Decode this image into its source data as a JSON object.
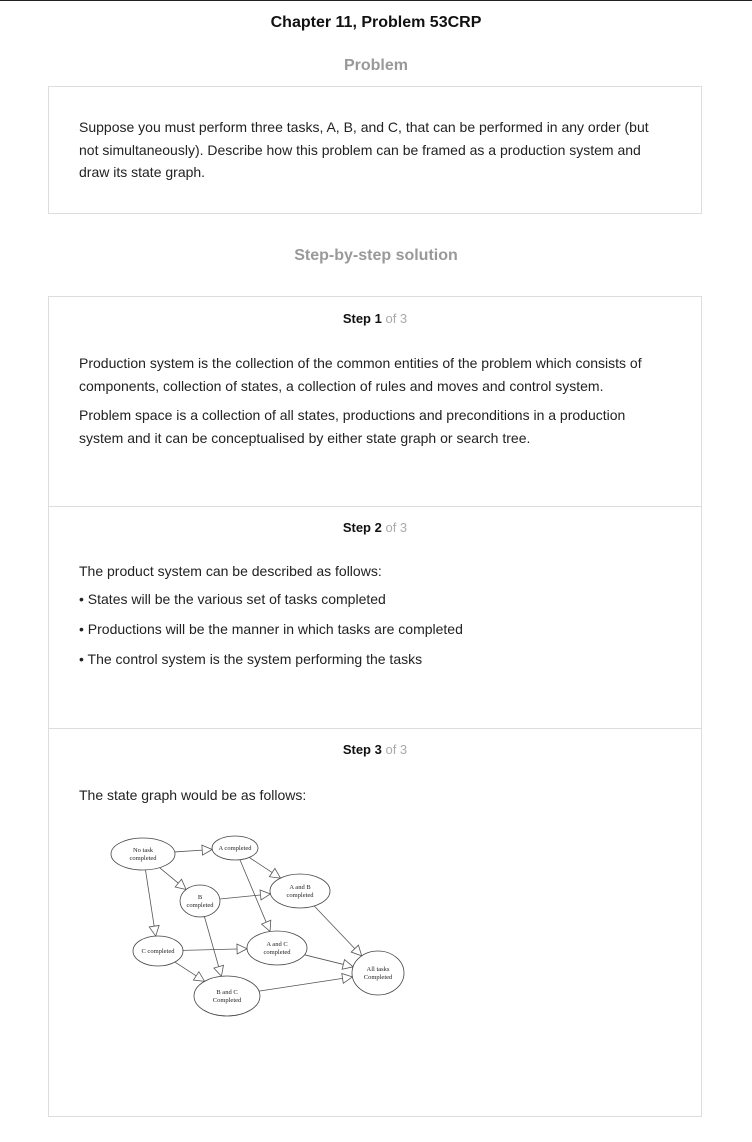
{
  "header": {
    "title": "Chapter 11, Problem 53CRP"
  },
  "problem": {
    "heading": "Problem",
    "text": "Suppose you must perform three tasks, A, B, and C, that can be performed in any order (but not simultaneously). Describe how this problem can be framed as a production system and draw its state graph."
  },
  "solution": {
    "heading": "Step-by-step solution",
    "steps": [
      {
        "label": "Step 1",
        "of": "of 3",
        "paragraphs": [
          "Production system is the collection of the common entities of the problem which consists of components, collection of states, a collection of rules and moves and control system.",
          "Problem space is a collection of all states, productions and preconditions in a production system and it can be conceptualised by either state graph or search tree."
        ]
      },
      {
        "label": "Step 2",
        "of": "of 3",
        "intro": "The product system can be described as follows:",
        "bullets": [
          "States will be the various set of tasks completed",
          "Productions will be the manner in which tasks are completed",
          "The control system is the system performing the tasks"
        ]
      },
      {
        "label": "Step 3",
        "of": "of 3",
        "intro": "The state graph would be as follows:"
      }
    ]
  },
  "diagram": {
    "nodes": [
      {
        "id": "none",
        "lines": [
          "No task",
          "completed"
        ]
      },
      {
        "id": "a",
        "lines": [
          "A completed"
        ]
      },
      {
        "id": "b",
        "lines": [
          "B",
          "completed"
        ]
      },
      {
        "id": "ab",
        "lines": [
          "A and B",
          "completed"
        ]
      },
      {
        "id": "c",
        "lines": [
          "C completed"
        ]
      },
      {
        "id": "ac",
        "lines": [
          "A and C",
          "completed"
        ]
      },
      {
        "id": "all",
        "lines": [
          "All tasks",
          "Completed"
        ]
      },
      {
        "id": "bc",
        "lines": [
          "B and C",
          "Completed"
        ]
      }
    ],
    "edges": [
      [
        "none",
        "a"
      ],
      [
        "none",
        "b"
      ],
      [
        "none",
        "c"
      ],
      [
        "a",
        "ab"
      ],
      [
        "a",
        "ac"
      ],
      [
        "b",
        "ab"
      ],
      [
        "b",
        "bc"
      ],
      [
        "c",
        "ac"
      ],
      [
        "c",
        "bc"
      ],
      [
        "ab",
        "all"
      ],
      [
        "ac",
        "all"
      ],
      [
        "bc",
        "all"
      ]
    ]
  }
}
